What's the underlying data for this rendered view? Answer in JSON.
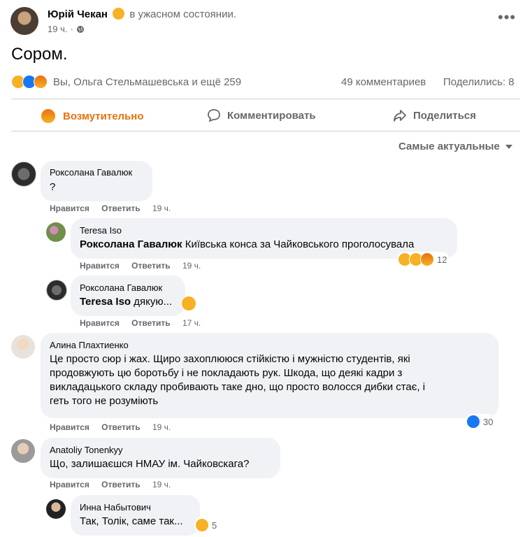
{
  "post": {
    "author": "Юрій Чекан",
    "feeling": "в ужасном состоянии.",
    "time": "19 ч.",
    "text": "Сором.",
    "reactions_summary": "Вы, Ольга Стельмашевська и ещё 259",
    "comments_count": "49 комментариев",
    "shares": "Поделились: 8"
  },
  "actions": {
    "react_label": "Возмутительно",
    "comment_label": "Комментировать",
    "share_label": "Поделиться"
  },
  "sort": {
    "label": "Самые актуальные"
  },
  "comment_actions": {
    "like": "Нравится",
    "reply": "Ответить"
  },
  "comments": [
    {
      "name": "Роксолана Гавалюк",
      "text": "?",
      "time": "19 ч."
    },
    {
      "name": "Teresa Iso",
      "mention": "Роксолана Гавалюк",
      "text": "Київська конса за Чайковського проголосувала",
      "time": "19 ч.",
      "reactions": "12"
    },
    {
      "name": "Роксолана Гавалюк",
      "mention": "Teresa Iso",
      "text": "дякую...",
      "time": "17 ч."
    },
    {
      "name": "Алина Плахтиенко",
      "text_lines": [
        "Це просто сюр і жах. Щиро захоплююся стійкістю і мужністю студентів, які",
        "продовжують цю боротьбу і не покладають рук. Шкода, що деякі кадри з",
        "викладацького складу пробивають таке дно, що просто волосся дибки стає, і",
        "геть того не розуміють"
      ],
      "time": "19 ч.",
      "reactions": "30"
    },
    {
      "name": "Anatoliy Tonenkyy",
      "text": "Що, залишаєшся НМАУ ім. Чайковскага?",
      "time": "19 ч."
    },
    {
      "name": "Инна Набытович",
      "text": "Так, Толік, саме так...",
      "reactions": "5"
    }
  ],
  "colors": {
    "accent": "#1877f2",
    "angry": "#e9710f",
    "bubble": "#f0f2f5",
    "muted": "#65676b"
  }
}
